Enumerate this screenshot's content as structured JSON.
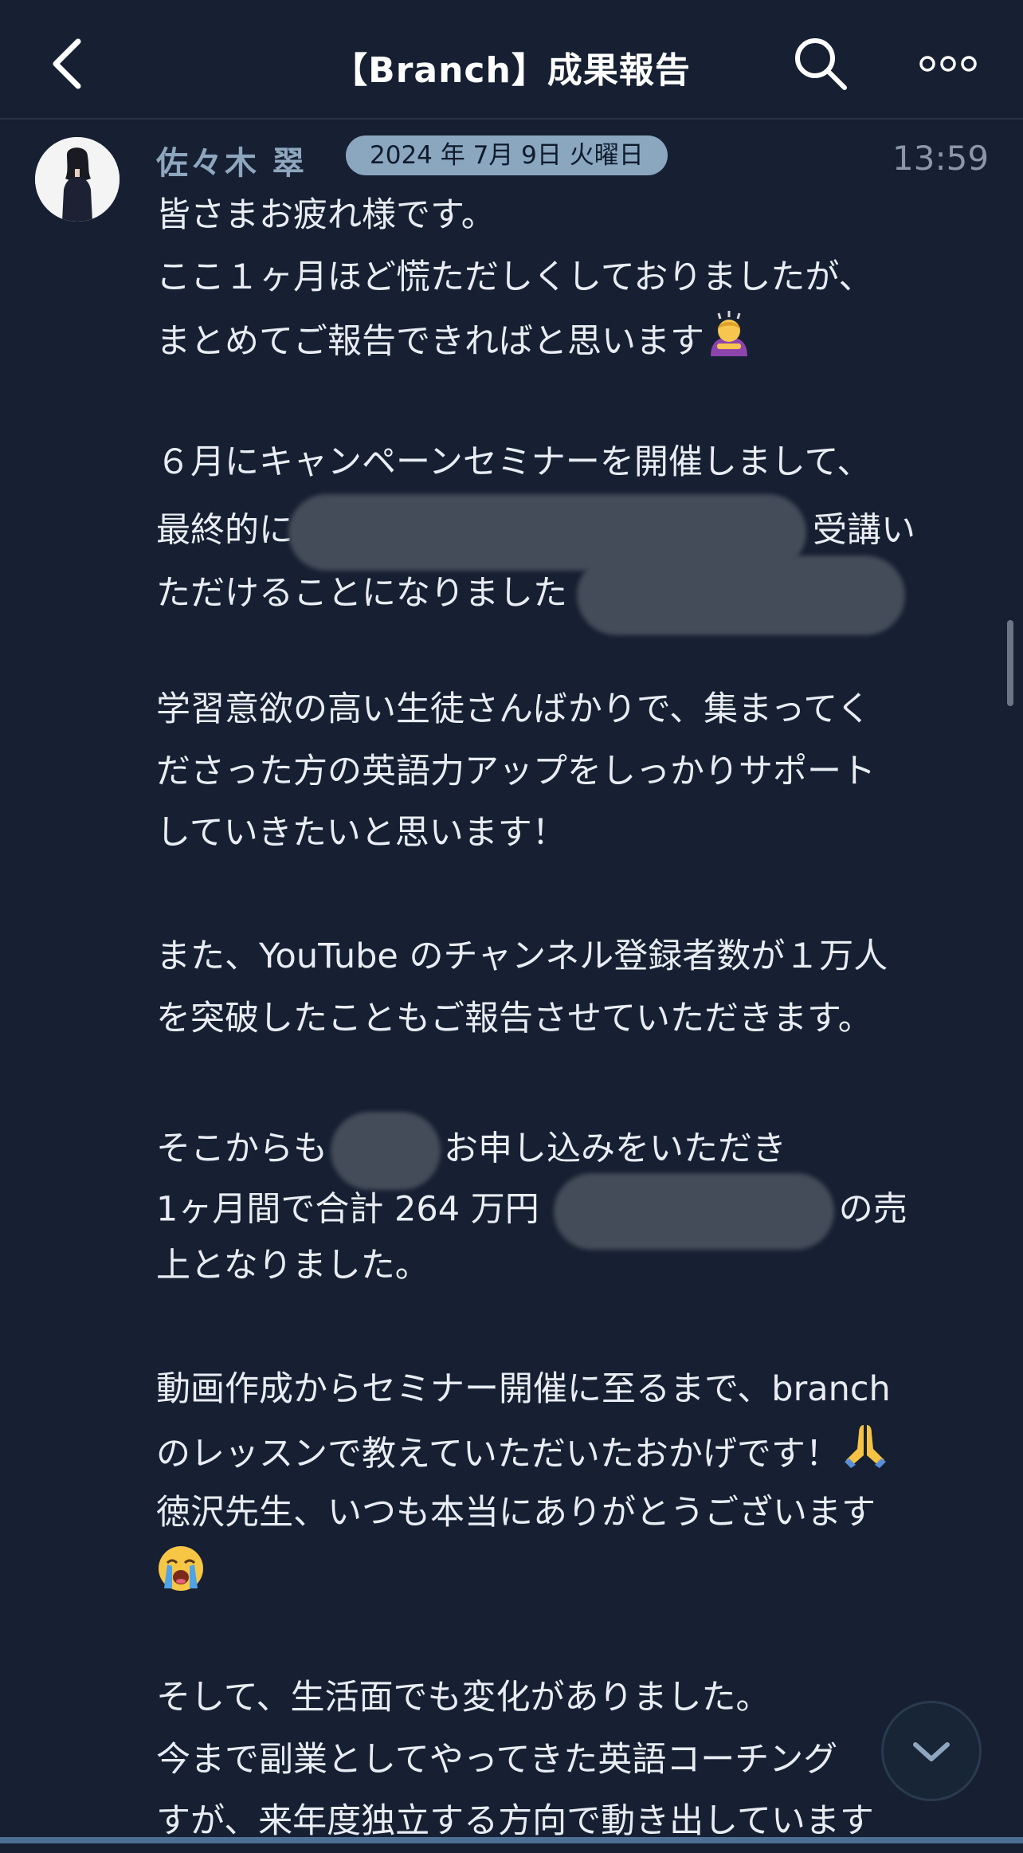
{
  "header": {
    "title": "【Branch】成果報告",
    "back_icon": "chevron-left-icon",
    "search_icon": "search-icon",
    "more_icon": "more-horizontal-icon"
  },
  "message": {
    "sender": "佐々木 翠",
    "date_badge": "2024 年 7月 9日 火曜日",
    "time": "13:59",
    "lines": {
      "l1": "皆さまお疲れ様です。",
      "l2": "ここ１ヶ月ほど慌ただしくしておりましたが、",
      "l3": "まとめてご報告できればと思います",
      "l5": "６月にキャンペーンセミナーを開催しまして、",
      "l6a": "最終的に",
      "l6b": "受講い",
      "l7": "ただけることになりました",
      "l9": "学習意欲の高い生徒さんばかりで、集まってく",
      "l10": "ださった方の英語力アップをしっかりサポート",
      "l11": "していきたいと思います！",
      "l13": "また、YouTube のチャンネル登録者数が１万人",
      "l14": "を突破したこともご報告させていただきます。",
      "l16a": "そこからも",
      "l16b": "お申し込みをいただき",
      "l17a": "1ヶ月間で合計 264 万円",
      "l17b": "の売",
      "l18": "上となりました。",
      "l20": "動画作成からセミナー開催に至るまで、branch",
      "l21": "のレッスンで教えていただいたおかげです！",
      "l22": "徳沢先生、いつも本当にありがとうございます",
      "l25": "そして、生活面でも変化がありました。",
      "l26": "今まで副業としてやってきた英語コーチング",
      "l27": "すが、来年度独立する方向で動き出しています"
    },
    "emoji_names": [
      "person-bowing-emoji",
      "folded-hands-emoji",
      "loudly-crying-emoji"
    ]
  },
  "scroll_button_icon": "chevron-down-icon",
  "colors": {
    "background": "#162032",
    "name": "#8ea6be",
    "badge": "#8aa7bf",
    "text": "#e9edf3"
  }
}
